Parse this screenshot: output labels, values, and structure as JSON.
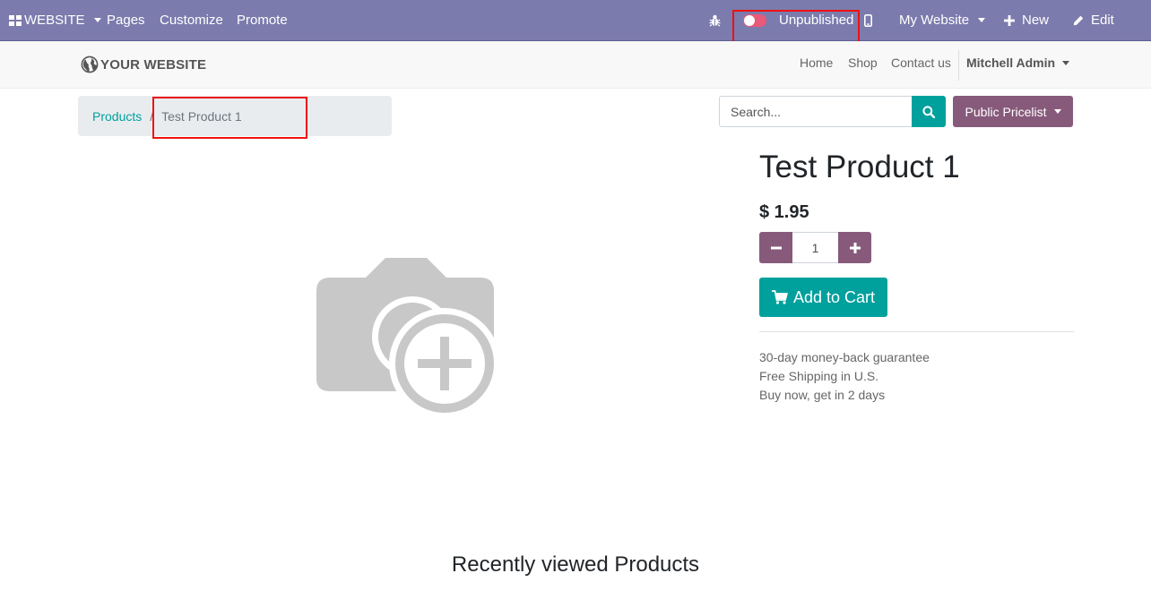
{
  "topbar": {
    "app_menu": "WEBSITE",
    "pages": "Pages",
    "customize": "Customize",
    "promote": "Promote",
    "publish_status": "Unpublished",
    "website_switcher": "My Website",
    "new": "New",
    "edit": "Edit",
    "bg_color": "#7c7bad"
  },
  "site_header": {
    "logo_text": "YOUR WEBSITE",
    "nav": {
      "home": "Home",
      "shop": "Shop",
      "contact": "Contact us"
    },
    "user": "Mitchell Admin"
  },
  "breadcrumb": {
    "parent": "Products",
    "separator": "/",
    "current": "Test Product 1"
  },
  "search": {
    "placeholder": "Search..."
  },
  "pricelist": {
    "label": "Public Pricelist"
  },
  "product": {
    "name": "Test Product 1",
    "price": "$ 1.95",
    "quantity": "1",
    "add_to_cart": "Add to Cart",
    "terms": [
      "30-day money-back guarantee",
      "Free Shipping in U.S.",
      "Buy now, get in 2 days"
    ]
  },
  "recently_viewed_title": "Recently viewed Products",
  "colors": {
    "primary": "#00a09d",
    "secondary": "#875a7b",
    "unpublished": "#e8597a"
  }
}
